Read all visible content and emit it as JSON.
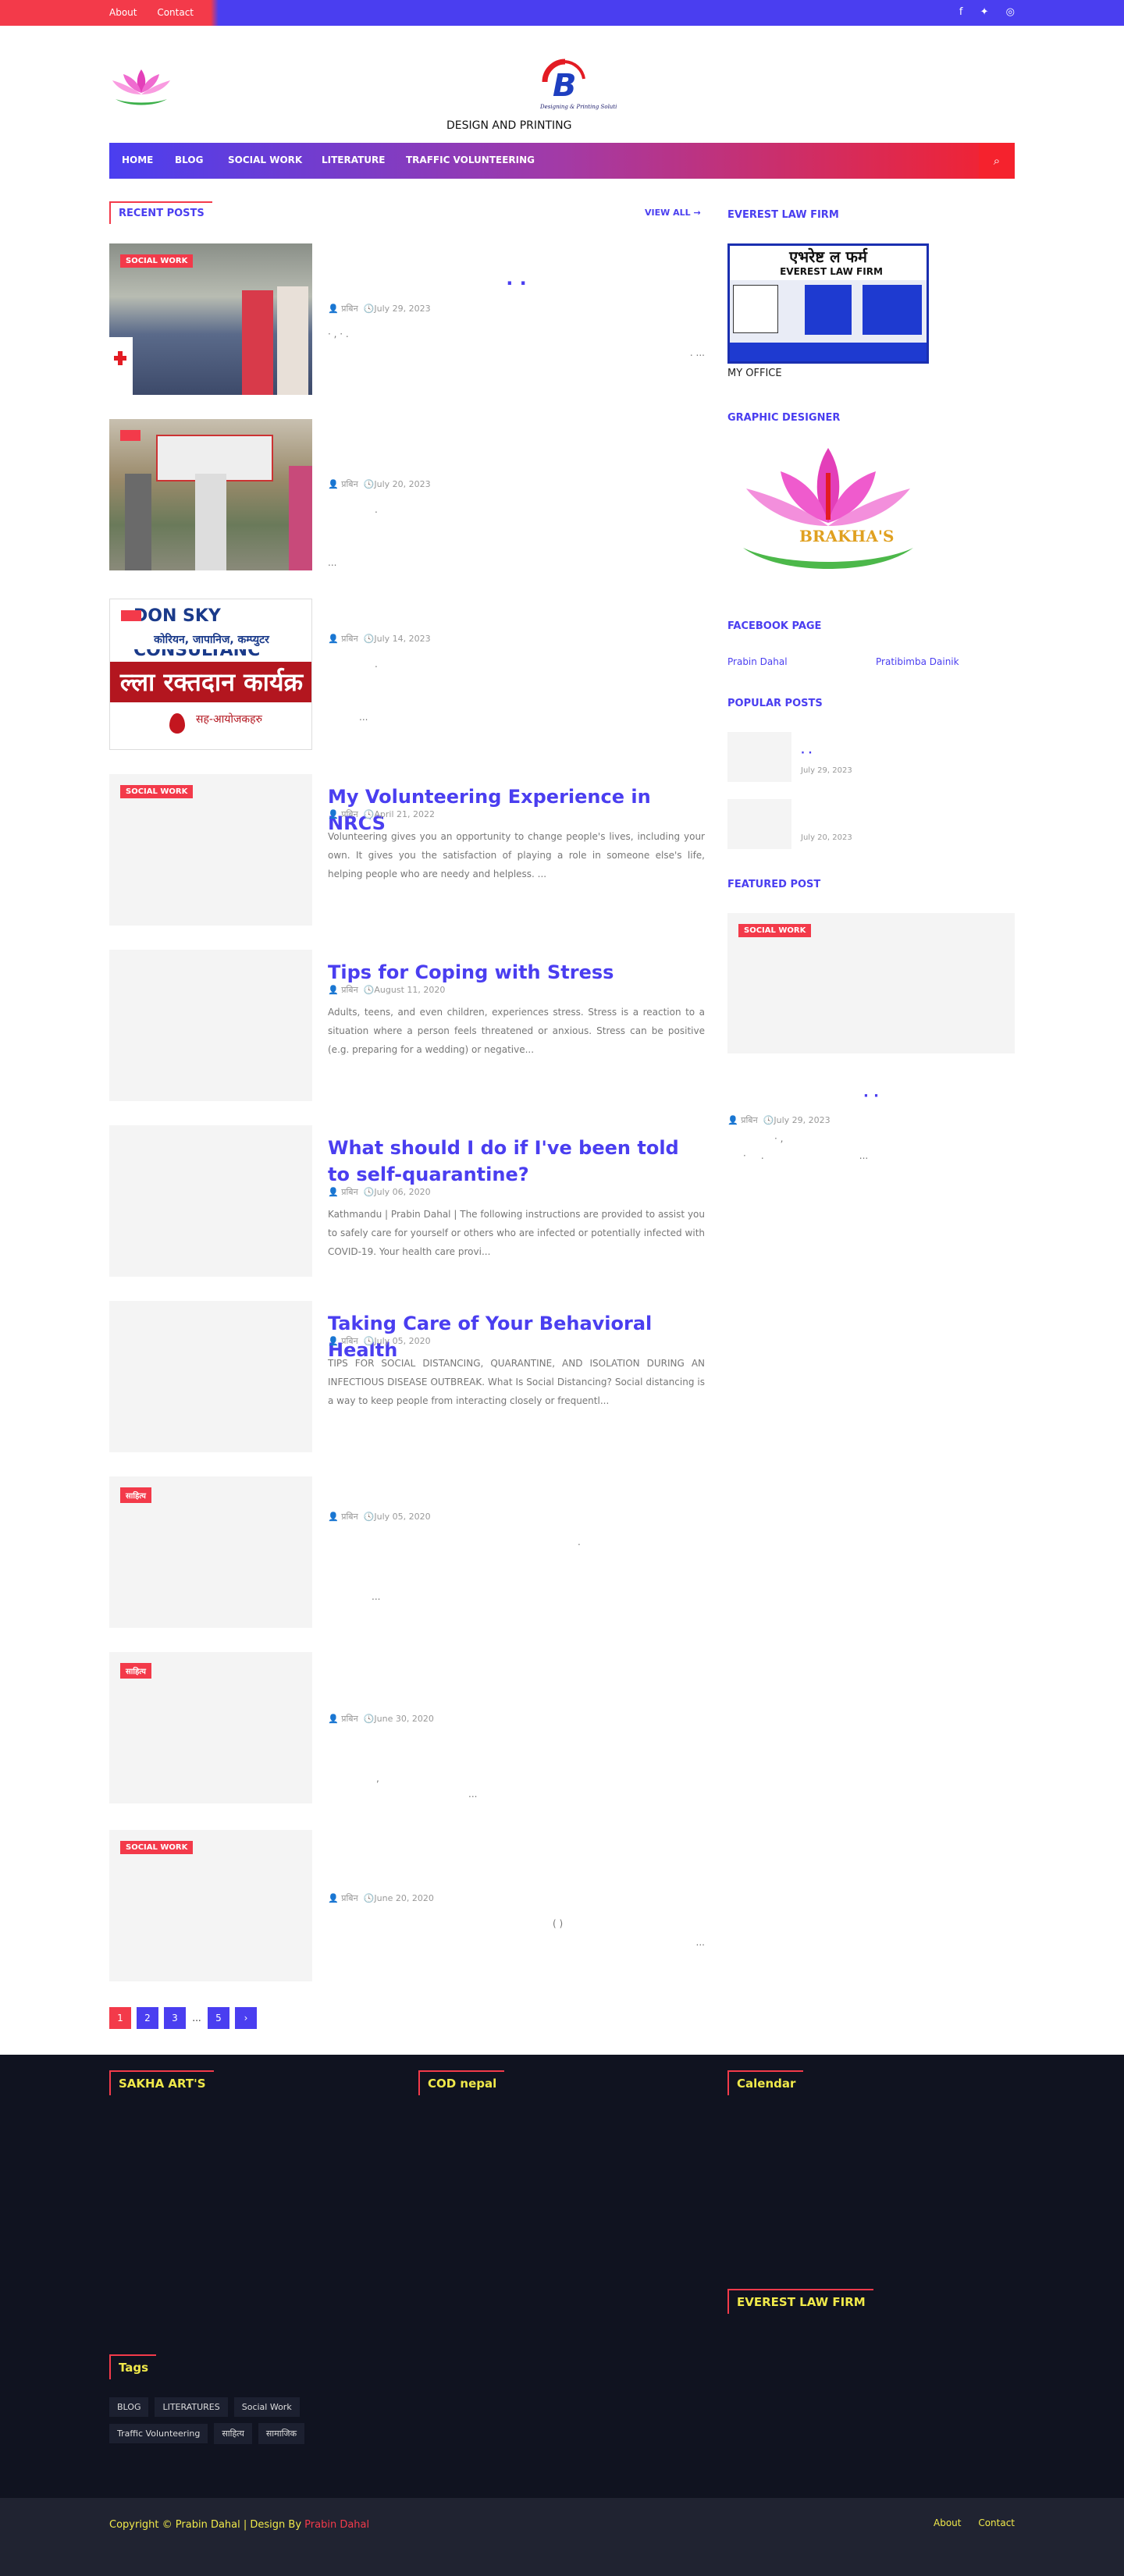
{
  "topbar": {
    "links": [
      "About",
      "Contact"
    ],
    "social_icons": [
      "facebook-icon",
      "twitter-icon",
      "instagram-icon"
    ]
  },
  "header": {
    "tagline": "DESIGN AND PRINTING",
    "logo_text": "B",
    "logo_sub": "Designing & Printing Solution"
  },
  "nav": {
    "items": [
      "HOME",
      "BLOG",
      "SOCIAL WORK",
      "LITERATURE",
      "TRAFFIC VOLUNTEERING"
    ],
    "search_icon": "search-icon"
  },
  "recent": {
    "title": "RECENT POSTS",
    "view_all": "VIEW ALL →"
  },
  "posts": [
    {
      "badge": "SOCIAL WORK",
      "title": "·   ·",
      "author": "प्रबिन",
      "date": "July 29, 2023",
      "desc": "·  ,                                   ·                     .",
      "desc2": ".                    ..."
    },
    {
      "badge": "",
      "title": "",
      "author": "प्रबिन",
      "date": "July 20, 2023",
      "desc": ".",
      "desc2": "..."
    },
    {
      "badge": "",
      "title": "",
      "author": "प्रबिन",
      "date": "July 14, 2023",
      "desc": ".",
      "desc2": "..."
    },
    {
      "badge": "SOCIAL WORK",
      "title": "My Volunteering Experience in NRCS",
      "author": "प्रबिन",
      "date": "April 21, 2022",
      "desc": "Volunteering gives you an opportunity to change people's lives, including your own. It gives you the satisfaction of playing a role in someone else's life, helping people who are needy and helpless. ..."
    },
    {
      "badge": "",
      "title": "Tips for Coping with Stress",
      "author": "प्रबिन",
      "date": "August 11, 2020",
      "desc": "Adults, teens, and even children, experiences stress. Stress is a reaction to a situation where a person feels threatened or anxious. Stress can be positive (e.g. preparing for a wedding) or negative..."
    },
    {
      "badge": "",
      "title": "What should I do if I've been told to self-quarantine?",
      "author": "प्रबिन",
      "date": "July 06, 2020",
      "desc": "Kathmandu | Prabin Dahal | The following instructions are provided to assist you to safely care for yourself or others who are infected or potentially infected with COVID-19. Your health care provi..."
    },
    {
      "badge": "",
      "title": "Taking Care of Your Behavioral Health",
      "author": "प्रबिन",
      "date": "July 05, 2020",
      "desc": "TIPS FOR SOCIAL DISTANCING, QUARANTINE, AND ISOLATION DURING AN INFECTIOUS DISEASE OUTBREAK. What Is Social Distancing? Social distancing is a way to keep people from interacting closely or frequentl..."
    },
    {
      "badge": "साहित्य",
      "title": "",
      "author": "प्रबिन",
      "date": "July 05, 2020",
      "desc": ".",
      "desc2": "..."
    },
    {
      "badge": "साहित्य",
      "title": "",
      "author": "प्रबिन",
      "date": "June 30, 2020",
      "desc": ",",
      "desc2": "..."
    },
    {
      "badge": "SOCIAL WORK",
      "title": "",
      "author": "प्रबिन",
      "date": "June 20, 2020",
      "desc": "(             )",
      "desc2": "..."
    }
  ],
  "pager": [
    "1",
    "2",
    "3",
    "...",
    "5",
    "›"
  ],
  "sidebar": {
    "law_title": "EVEREST LAW FIRM",
    "law_heading": "एभरेष्ट ल फर्म",
    "law_sub": "EVEREST LAW FIRM",
    "law_caption": "MY OFFICE",
    "designer_title": "GRAPHIC DESIGNER",
    "designer_logo": "BRAKHA'S",
    "fb_title": "FACEBOOK PAGE",
    "fb_links": [
      "Prabin Dahal",
      "Pratibimba Dainik"
    ],
    "popular_title": "POPULAR POSTS",
    "popular": [
      {
        "title": "·   ·",
        "date": "July 29, 2023"
      },
      {
        "title": "",
        "date": "July 20, 2023"
      }
    ],
    "featured_title": "FEATURED POST",
    "featured_badge": "SOCIAL WORK",
    "featured_post_title": "·   ·",
    "featured_author": "प्रबिन",
    "featured_date": "July 29, 2023",
    "featured_desc": "·  ,",
    "featured_desc2": "·     .                                ..."
  },
  "footer": {
    "col1": "SAKHA ART'S",
    "col2": "COD nepal",
    "col3": "Calendar",
    "col3b": "EVEREST LAW FIRM",
    "tags_title": "Tags",
    "tags": [
      "BLOG",
      "LITERATURES",
      "Social Work",
      "Traffic Volunteering",
      "साहित्य",
      "सामाजिक"
    ],
    "copyright": "Copyright © Prabin Dahal | Design By",
    "design_by": "Prabin Dahal",
    "bottom_links": [
      "About",
      "Contact"
    ]
  }
}
